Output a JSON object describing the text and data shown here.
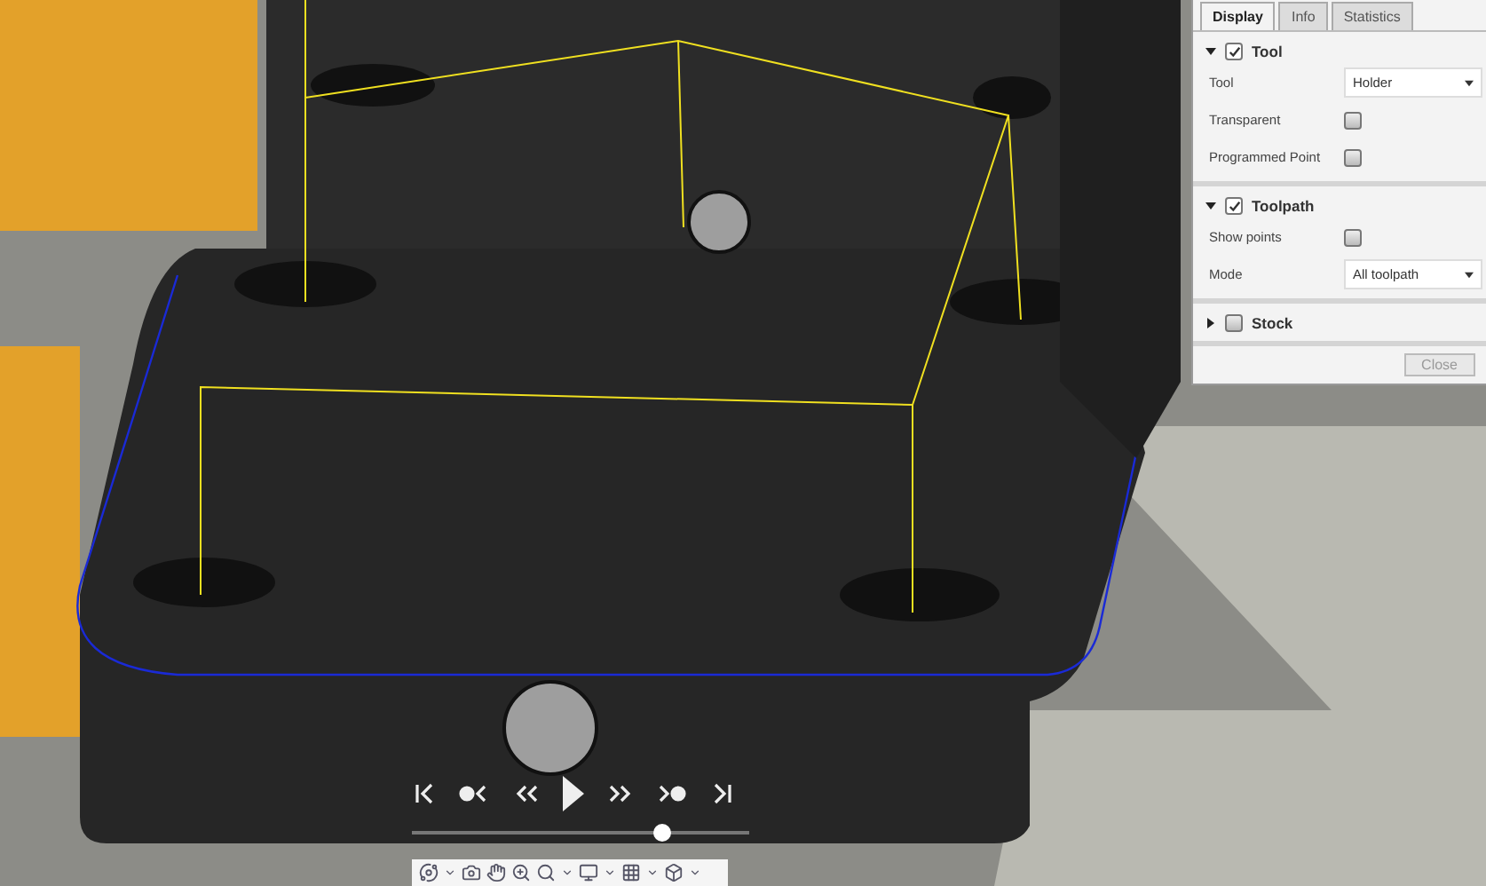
{
  "panel": {
    "tabs": [
      {
        "label": "Display",
        "selected": true
      },
      {
        "label": "Info",
        "selected": false
      },
      {
        "label": "Statistics",
        "selected": false
      }
    ],
    "sections": [
      {
        "title": "Tool",
        "expanded": true,
        "checked": true,
        "rows": [
          {
            "kind": "dropdown",
            "label": "Tool",
            "value": "Holder"
          },
          {
            "kind": "checkbox",
            "label": "Transparent",
            "checked": false
          },
          {
            "kind": "checkbox",
            "label": "Programmed Point",
            "checked": false
          }
        ]
      },
      {
        "title": "Toolpath",
        "expanded": true,
        "checked": true,
        "rows": [
          {
            "kind": "checkbox",
            "label": "Show points",
            "checked": false
          },
          {
            "kind": "dropdown",
            "label": "Mode",
            "value": "All toolpath"
          }
        ]
      },
      {
        "title": "Stock",
        "expanded": false,
        "checked": false
      }
    ],
    "close_button": {
      "label": "Close",
      "disabled": true
    }
  },
  "playback": {
    "level": 0.74
  }
}
